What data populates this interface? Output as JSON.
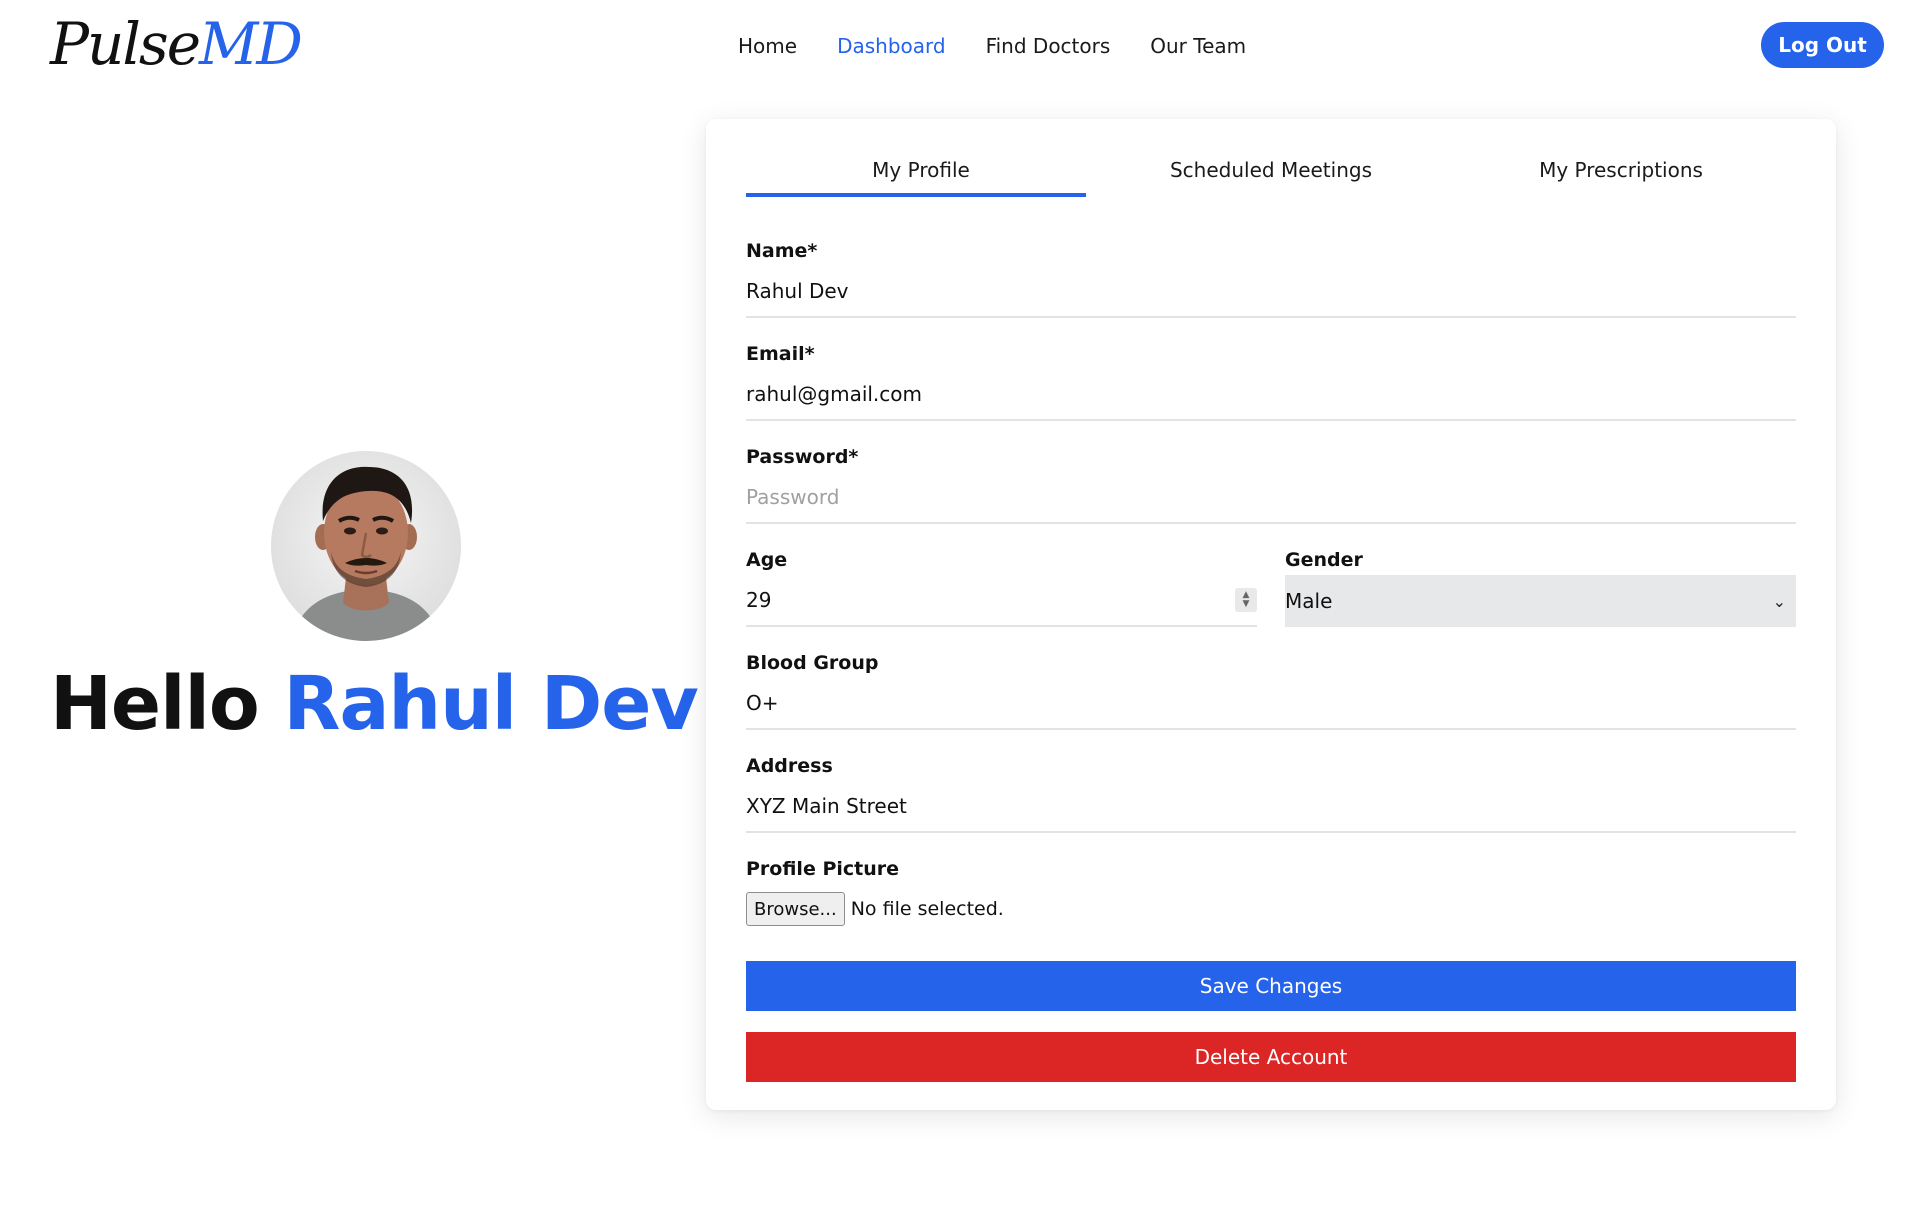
{
  "brand": {
    "part1": "Pulse",
    "part2": "MD",
    "accent_color": "#2563eb"
  },
  "nav": {
    "items": [
      {
        "label": "Home",
        "active": false
      },
      {
        "label": "Dashboard",
        "active": true
      },
      {
        "label": "Find Doctors",
        "active": false
      },
      {
        "label": "Our Team",
        "active": false
      }
    ],
    "logout_label": "Log Out"
  },
  "greeting": {
    "hello": "Hello",
    "name": "Rahul Dev!"
  },
  "tabs": [
    {
      "label": "My Profile",
      "active": true
    },
    {
      "label": "Scheduled Meetings",
      "active": false
    },
    {
      "label": "My Prescriptions",
      "active": false
    }
  ],
  "form": {
    "name": {
      "label": "Name*",
      "value": "Rahul Dev"
    },
    "email": {
      "label": "Email*",
      "value": "rahul@gmail.com"
    },
    "password": {
      "label": "Password*",
      "value": "",
      "placeholder": "Password"
    },
    "age": {
      "label": "Age",
      "value": "29"
    },
    "gender": {
      "label": "Gender",
      "value": "Male"
    },
    "blood_group": {
      "label": "Blood Group",
      "value": "O+"
    },
    "address": {
      "label": "Address",
      "value": "XYZ Main Street"
    },
    "profile_picture": {
      "label": "Profile Picture",
      "browse_label": "Browse...",
      "status": "No file selected."
    }
  },
  "actions": {
    "save_label": "Save Changes",
    "delete_label": "Delete Account",
    "save_color": "#2563eb",
    "delete_color": "#dc2626"
  }
}
